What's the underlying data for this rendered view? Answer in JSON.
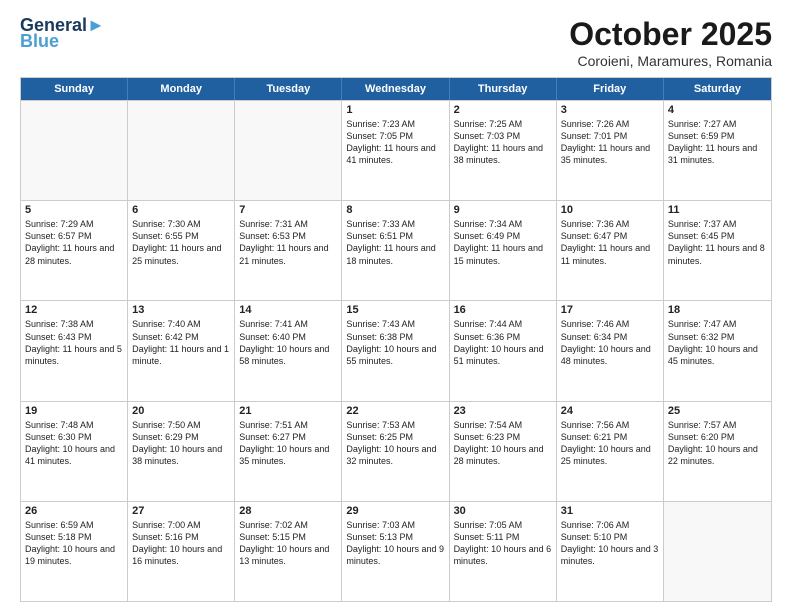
{
  "logo": {
    "line1": "General",
    "line2": "Blue"
  },
  "title": "October 2025",
  "subtitle": "Coroieni, Maramures, Romania",
  "header_days": [
    "Sunday",
    "Monday",
    "Tuesday",
    "Wednesday",
    "Thursday",
    "Friday",
    "Saturday"
  ],
  "weeks": [
    [
      {
        "day": "",
        "text": ""
      },
      {
        "day": "",
        "text": ""
      },
      {
        "day": "",
        "text": ""
      },
      {
        "day": "1",
        "text": "Sunrise: 7:23 AM\nSunset: 7:05 PM\nDaylight: 11 hours and 41 minutes."
      },
      {
        "day": "2",
        "text": "Sunrise: 7:25 AM\nSunset: 7:03 PM\nDaylight: 11 hours and 38 minutes."
      },
      {
        "day": "3",
        "text": "Sunrise: 7:26 AM\nSunset: 7:01 PM\nDaylight: 11 hours and 35 minutes."
      },
      {
        "day": "4",
        "text": "Sunrise: 7:27 AM\nSunset: 6:59 PM\nDaylight: 11 hours and 31 minutes."
      }
    ],
    [
      {
        "day": "5",
        "text": "Sunrise: 7:29 AM\nSunset: 6:57 PM\nDaylight: 11 hours and 28 minutes."
      },
      {
        "day": "6",
        "text": "Sunrise: 7:30 AM\nSunset: 6:55 PM\nDaylight: 11 hours and 25 minutes."
      },
      {
        "day": "7",
        "text": "Sunrise: 7:31 AM\nSunset: 6:53 PM\nDaylight: 11 hours and 21 minutes."
      },
      {
        "day": "8",
        "text": "Sunrise: 7:33 AM\nSunset: 6:51 PM\nDaylight: 11 hours and 18 minutes."
      },
      {
        "day": "9",
        "text": "Sunrise: 7:34 AM\nSunset: 6:49 PM\nDaylight: 11 hours and 15 minutes."
      },
      {
        "day": "10",
        "text": "Sunrise: 7:36 AM\nSunset: 6:47 PM\nDaylight: 11 hours and 11 minutes."
      },
      {
        "day": "11",
        "text": "Sunrise: 7:37 AM\nSunset: 6:45 PM\nDaylight: 11 hours and 8 minutes."
      }
    ],
    [
      {
        "day": "12",
        "text": "Sunrise: 7:38 AM\nSunset: 6:43 PM\nDaylight: 11 hours and 5 minutes."
      },
      {
        "day": "13",
        "text": "Sunrise: 7:40 AM\nSunset: 6:42 PM\nDaylight: 11 hours and 1 minute."
      },
      {
        "day": "14",
        "text": "Sunrise: 7:41 AM\nSunset: 6:40 PM\nDaylight: 10 hours and 58 minutes."
      },
      {
        "day": "15",
        "text": "Sunrise: 7:43 AM\nSunset: 6:38 PM\nDaylight: 10 hours and 55 minutes."
      },
      {
        "day": "16",
        "text": "Sunrise: 7:44 AM\nSunset: 6:36 PM\nDaylight: 10 hours and 51 minutes."
      },
      {
        "day": "17",
        "text": "Sunrise: 7:46 AM\nSunset: 6:34 PM\nDaylight: 10 hours and 48 minutes."
      },
      {
        "day": "18",
        "text": "Sunrise: 7:47 AM\nSunset: 6:32 PM\nDaylight: 10 hours and 45 minutes."
      }
    ],
    [
      {
        "day": "19",
        "text": "Sunrise: 7:48 AM\nSunset: 6:30 PM\nDaylight: 10 hours and 41 minutes."
      },
      {
        "day": "20",
        "text": "Sunrise: 7:50 AM\nSunset: 6:29 PM\nDaylight: 10 hours and 38 minutes."
      },
      {
        "day": "21",
        "text": "Sunrise: 7:51 AM\nSunset: 6:27 PM\nDaylight: 10 hours and 35 minutes."
      },
      {
        "day": "22",
        "text": "Sunrise: 7:53 AM\nSunset: 6:25 PM\nDaylight: 10 hours and 32 minutes."
      },
      {
        "day": "23",
        "text": "Sunrise: 7:54 AM\nSunset: 6:23 PM\nDaylight: 10 hours and 28 minutes."
      },
      {
        "day": "24",
        "text": "Sunrise: 7:56 AM\nSunset: 6:21 PM\nDaylight: 10 hours and 25 minutes."
      },
      {
        "day": "25",
        "text": "Sunrise: 7:57 AM\nSunset: 6:20 PM\nDaylight: 10 hours and 22 minutes."
      }
    ],
    [
      {
        "day": "26",
        "text": "Sunrise: 6:59 AM\nSunset: 5:18 PM\nDaylight: 10 hours and 19 minutes."
      },
      {
        "day": "27",
        "text": "Sunrise: 7:00 AM\nSunset: 5:16 PM\nDaylight: 10 hours and 16 minutes."
      },
      {
        "day": "28",
        "text": "Sunrise: 7:02 AM\nSunset: 5:15 PM\nDaylight: 10 hours and 13 minutes."
      },
      {
        "day": "29",
        "text": "Sunrise: 7:03 AM\nSunset: 5:13 PM\nDaylight: 10 hours and 9 minutes."
      },
      {
        "day": "30",
        "text": "Sunrise: 7:05 AM\nSunset: 5:11 PM\nDaylight: 10 hours and 6 minutes."
      },
      {
        "day": "31",
        "text": "Sunrise: 7:06 AM\nSunset: 5:10 PM\nDaylight: 10 hours and 3 minutes."
      },
      {
        "day": "",
        "text": ""
      }
    ]
  ]
}
